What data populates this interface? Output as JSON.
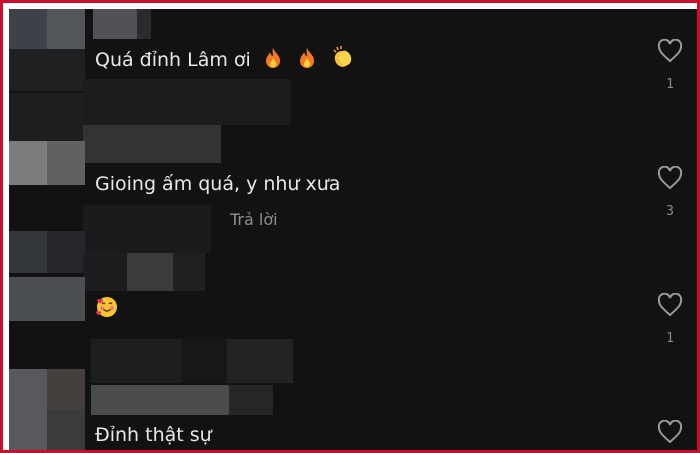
{
  "comments": [
    {
      "text": "Quá đỉnh Lâm ơi",
      "emojis": [
        "fire-emoji",
        "fire-emoji",
        "clapping-hands-emoji"
      ],
      "likes": "1"
    },
    {
      "text": "Gioing ấm quá, y như xưa",
      "likes": "3",
      "reply_label": "Trả lời"
    },
    {
      "text": "",
      "emojis": [
        "smiling-face-with-hearts-emoji"
      ],
      "likes": "1"
    },
    {
      "text": "Đỉnh thật sự"
    }
  ],
  "colors": {
    "background": "#121212",
    "frame_border": "#c8102e",
    "text": "#e8e8e8",
    "muted": "#8a8a8a"
  }
}
